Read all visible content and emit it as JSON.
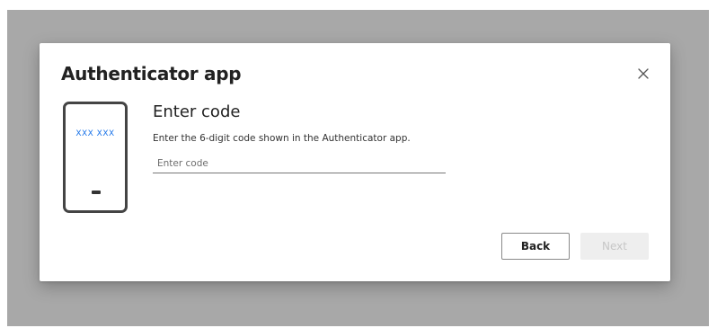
{
  "dialog": {
    "title": "Authenticator app",
    "close_icon": "close-icon"
  },
  "illustration": {
    "icon": "phone-icon",
    "code_text": "XXX XXX",
    "accent_color": "#1a73e8"
  },
  "form": {
    "heading": "Enter code",
    "description": "Enter the 6-digit code shown in the Authenticator app.",
    "input_value": "",
    "input_placeholder": "Enter code"
  },
  "buttons": {
    "back_label": "Back",
    "next_label": "Next",
    "next_enabled": false
  }
}
